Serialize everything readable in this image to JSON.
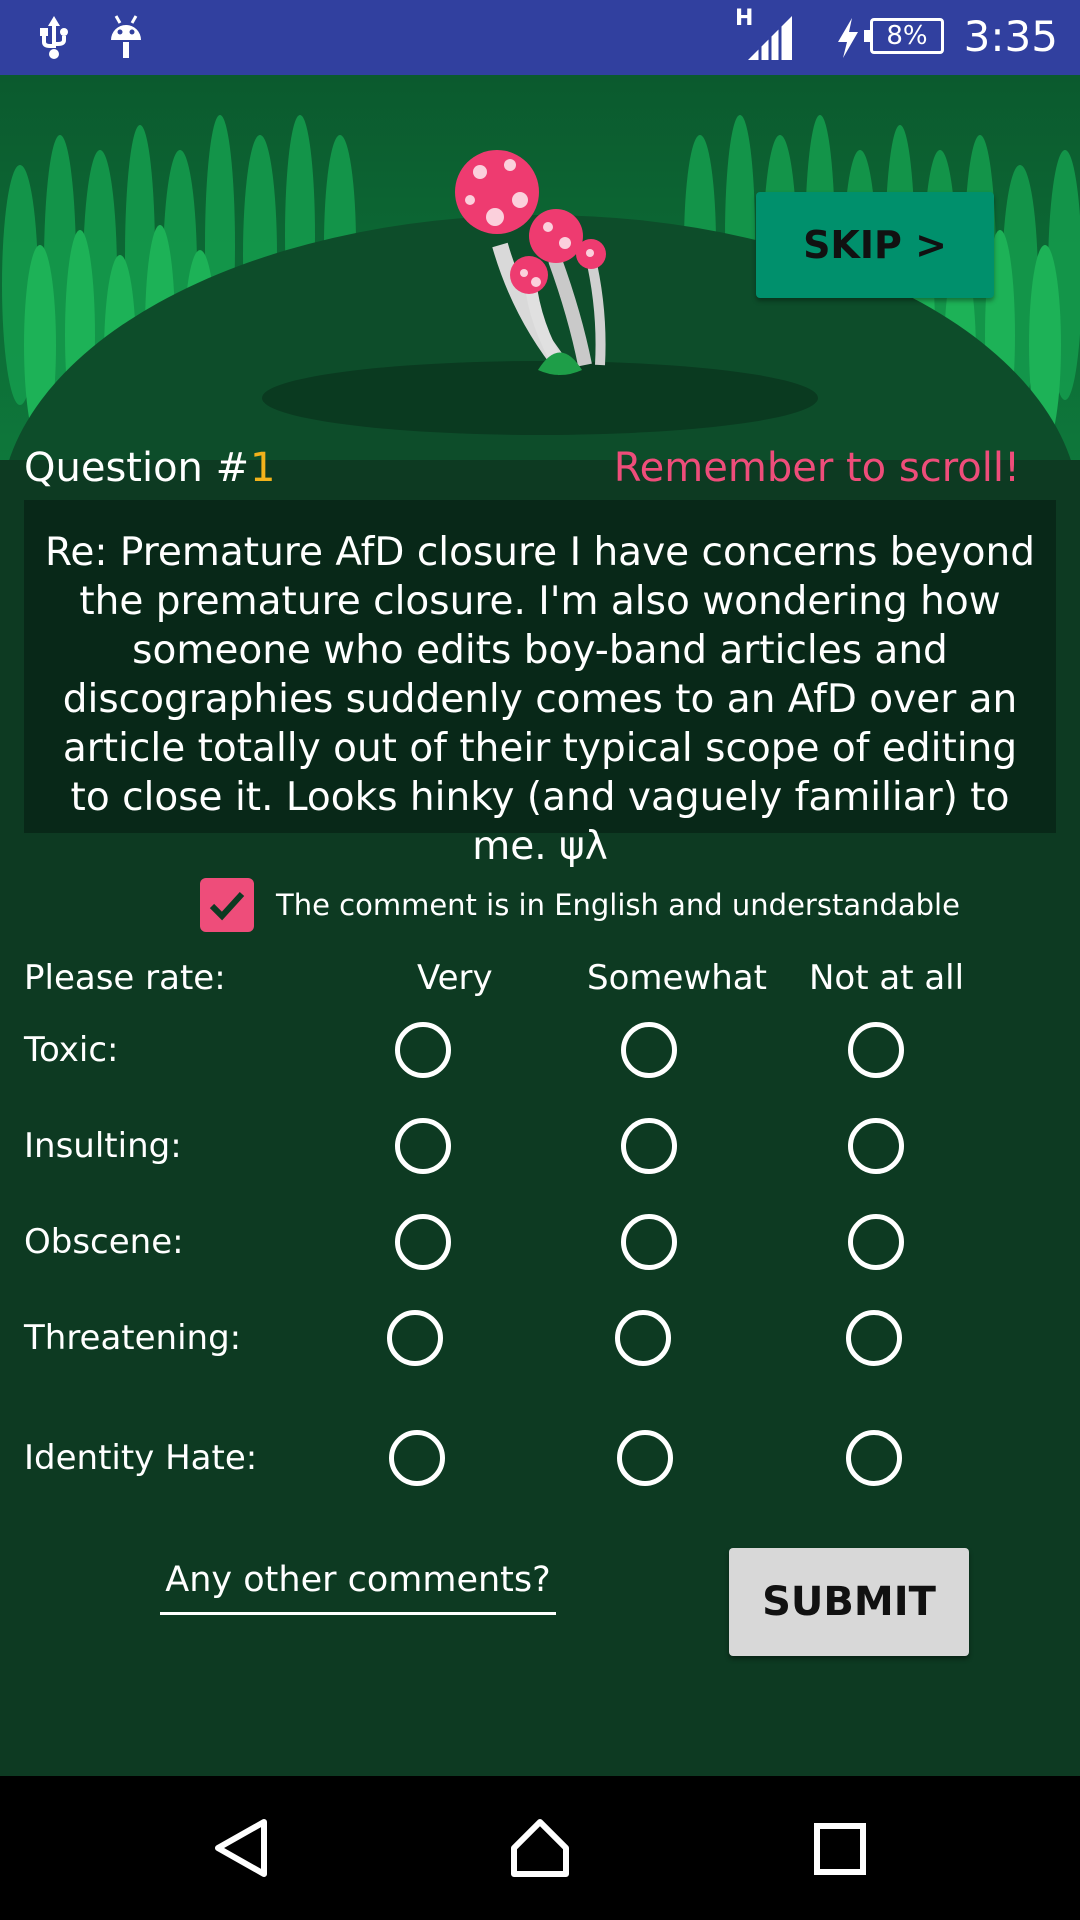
{
  "status_bar": {
    "network": "H",
    "battery": "8%",
    "time": "3:35"
  },
  "skip_label": "SKIP >",
  "question": {
    "label": "Question #",
    "number": "1",
    "hint": "Remember to scroll!"
  },
  "comment_text": "Re: Premature AfD closure I have concerns beyond the premature closure. I'm also wondering how someone who edits boy-band articles and discographies suddenly comes to an AfD over an article totally out of their typical scope of editing to close it. Looks hinky (and vaguely familiar) to me. ψλ",
  "english_check": {
    "label": "The comment is in English and understandable",
    "checked": true
  },
  "rating": {
    "prompt": "Please rate:",
    "columns": [
      "Very",
      "Somewhat",
      "Not at all"
    ],
    "rows": [
      "Toxic:",
      "Insulting:",
      "Obscene:",
      "Threatening:",
      "Identity Hate:"
    ]
  },
  "comments_placeholder": "Any other comments?",
  "submit_label": "SUBMIT",
  "colors": {
    "status_bar": "#31409f",
    "accent_pink": "#ee4d7a",
    "question_number": "#f2b21b",
    "skip_button": "#00906c",
    "background": "#0d3a22"
  },
  "icons": [
    "usb-icon",
    "android-icon",
    "signal-icon",
    "charging-icon",
    "back-icon",
    "home-icon",
    "recents-icon"
  ]
}
